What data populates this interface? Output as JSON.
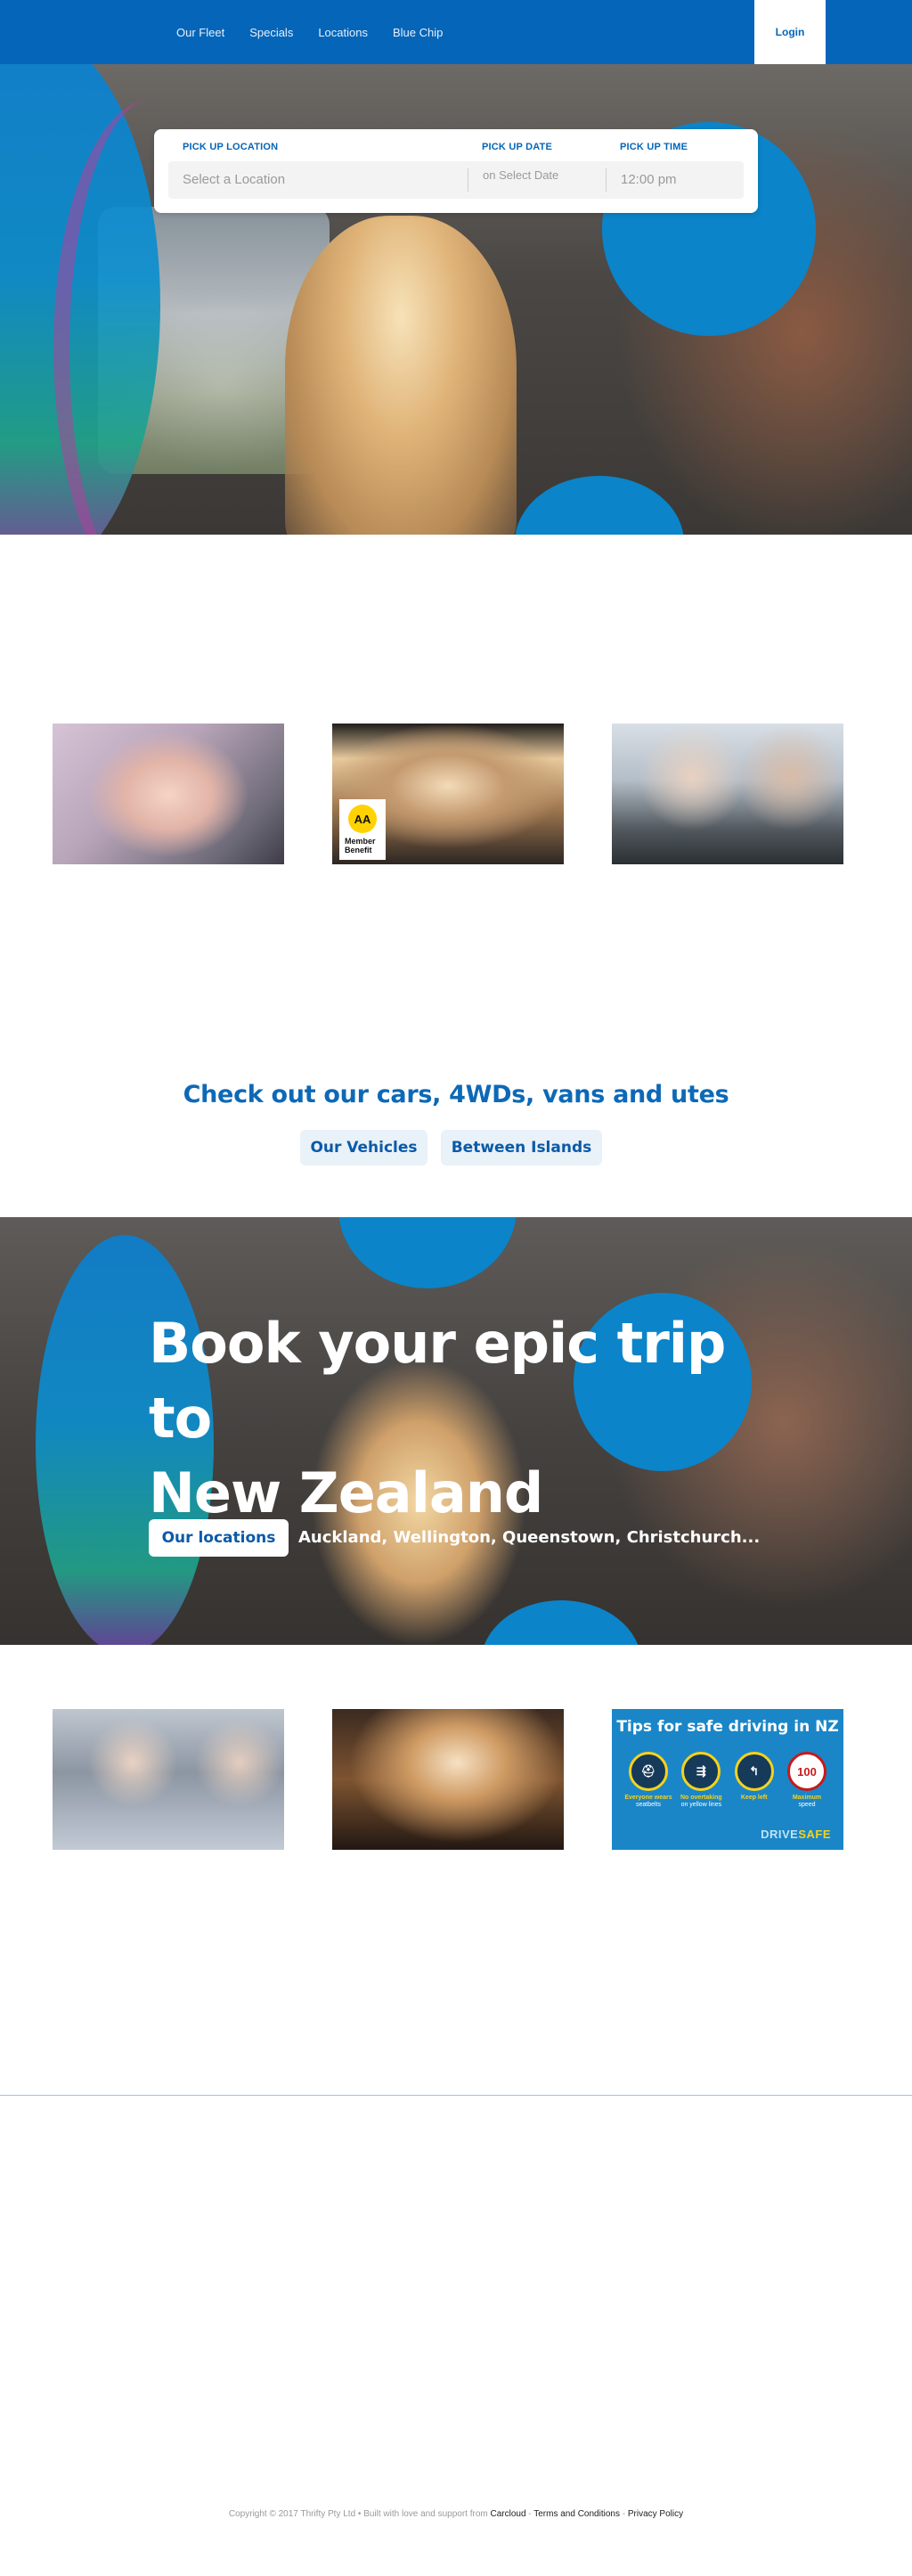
{
  "nav": {
    "links": [
      "Our Fleet",
      "Specials",
      "Locations",
      "Blue Chip"
    ],
    "login": "Login"
  },
  "search": {
    "location_label": "PICK UP LOCATION",
    "location_placeholder": "Select a Location",
    "date_label": "PICK UP DATE",
    "date_placeholder": "on Select Date",
    "time_label": "PICK UP TIME",
    "time_value": "12:00 pm"
  },
  "promo_tiles": {
    "aa_logo": "AA",
    "aa_badge_line1": "Member",
    "aa_badge_line2": "Benefit"
  },
  "cars": {
    "heading": "Check out our cars, 4WDs, vans and utes",
    "buttons": [
      "Our Vehicles",
      "Between Islands"
    ]
  },
  "trip": {
    "title_line1": "Book your epic trip to",
    "title_line2": "New Zealand",
    "locations_button": "Our locations",
    "locations_text": "Auckland, Wellington, Queenstown, Christchurch..."
  },
  "tips": {
    "title": "Tips for safe driving in NZ",
    "items": [
      {
        "icon": "seatbelt-icon",
        "symbol": "⛑",
        "highlight": "Everyone wears",
        "rest": "seatbelts"
      },
      {
        "icon": "no-overtaking-icon",
        "symbol": "⇶",
        "highlight": "No overtaking",
        "rest": "on yellow lines"
      },
      {
        "icon": "keep-left-icon",
        "symbol": "↰",
        "highlight": "Keep left",
        "rest": ""
      },
      {
        "icon": "speed-limit-icon",
        "symbol": "100",
        "highlight": "Maximum",
        "rest": "speed"
      }
    ],
    "brand_main": "DRIVE",
    "brand_accent": "SAFE"
  },
  "footer": {
    "copyright": "Copyright © 2017 Thrifty Pty Ltd • Built with love and support from",
    "links": [
      "Carcloud",
      "Terms and Conditions",
      "Privacy Policy"
    ],
    "sep": " - "
  },
  "colors": {
    "brand_blue": "#0565b8",
    "accent_blue": "#0b84c9",
    "heading_blue": "#0d69b6",
    "pill_bg": "#e9f1f9"
  }
}
